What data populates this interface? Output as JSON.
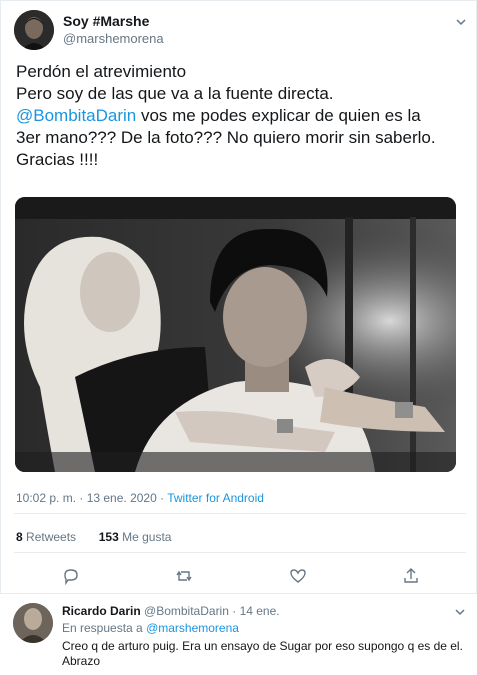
{
  "tweet": {
    "display_name": "Soy #Marshe",
    "handle": "@marshemorena",
    "text_line1": "Perdón el atrevimiento",
    "text_line2": "Pero soy de las que va a la fuente directa.",
    "mention": "@BombitaDarin",
    "text_line3_rest": " vos me podes explicar de quien es la",
    "text_line4": "3er mano??? De la foto??? No quiero morir sin saberlo.",
    "text_line5": "Gracias !!!!",
    "time": "10:02 p. m. · 13 ene. 2020 · ",
    "source": "Twitter for Android",
    "retweets_count": "8",
    "retweets_label": " Retweets",
    "likes_count": "153",
    "likes_label": " Me gusta",
    "icons": [
      "chevron-down-icon",
      "reply-icon",
      "retweet-icon",
      "like-icon",
      "share-icon"
    ]
  },
  "reply": {
    "display_name": "Ricardo Darin",
    "handle": " @BombitaDarin · 14 ene.",
    "in_reply_prefix": "En respuesta a ",
    "in_reply_handle": "@marshemorena",
    "text": "Creo q de arturo puig. Era un ensayo de Sugar por eso supongo q es de el. Abrazo"
  },
  "colors": {
    "accent": "#1b95e0",
    "secondary_text": "#657786",
    "border": "#e6ecf0"
  }
}
